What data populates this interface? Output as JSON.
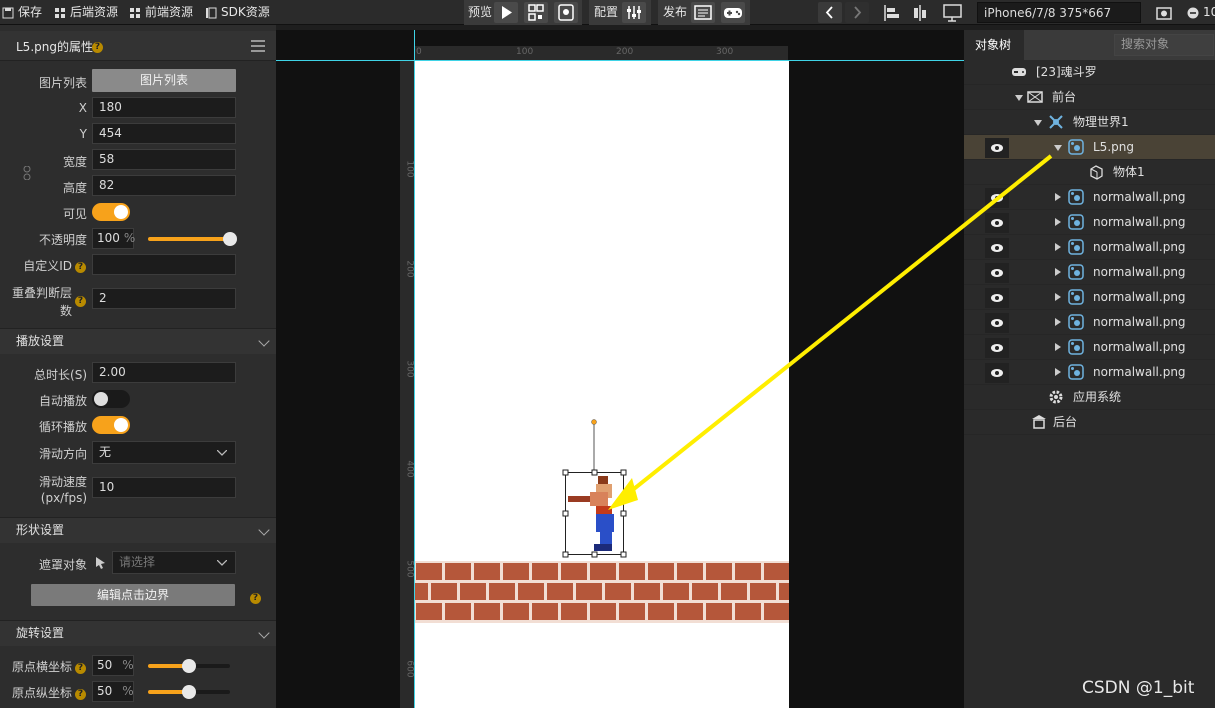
{
  "toolbar": {
    "save": "保存",
    "backend_assets": "后端资源",
    "frontend_assets": "前端资源",
    "sdk_assets": "SDK资源",
    "preview": "预览",
    "config": "配置",
    "publish": "发布",
    "device": "iPhone6/7/8 375*667",
    "zoom": "10"
  },
  "left_panel": {
    "title": "L5.png的属性",
    "image_list_label": "图片列表",
    "image_list_button": "图片列表",
    "x_label": "X",
    "x_value": "180",
    "y_label": "Y",
    "y_value": "454",
    "width_label": "宽度",
    "width_value": "58",
    "height_label": "高度",
    "height_value": "82",
    "visible_label": "可见",
    "visible": true,
    "opacity_label": "不透明度",
    "opacity_value": "100",
    "opacity_unit": "%",
    "opacity_level": 1.0,
    "custom_id_label": "自定义ID",
    "custom_id_value": "",
    "overlap_label_1": "重叠判断层",
    "overlap_label_2": "数",
    "overlap_value": "2",
    "playback": {
      "title": "播放设置",
      "duration_label": "总时长(S)",
      "duration_value": "2.00",
      "autoplay_label": "自动播放",
      "autoplay": false,
      "loop_label": "循环播放",
      "loop": true,
      "scroll_dir_label": "滑动方向",
      "scroll_dir_value": "无",
      "scroll_speed_label_1": "滑动速度",
      "scroll_speed_label_2": "(px/fps)",
      "scroll_speed_value": "10"
    },
    "shape": {
      "title": "形状设置",
      "mask_label": "遮罩对象",
      "mask_placeholder": "请选择",
      "edit_bounds_button": "编辑点击边界"
    },
    "rotation": {
      "title": "旋转设置",
      "origin_x_label": "原点横坐标",
      "origin_x_value": "50",
      "origin_y_label": "原点纵坐标",
      "origin_y_value": "50",
      "unit": "%",
      "origin_x_level": 0.5,
      "origin_y_level": 0.5
    }
  },
  "canvas": {
    "ruler_h": [
      "0",
      "100",
      "200",
      "300"
    ],
    "ruler_v": [
      "100",
      "200",
      "300",
      "400",
      "500",
      "600"
    ]
  },
  "right_panel": {
    "tab_tree": "对象树",
    "search_placeholder": "搜索对象",
    "nodes": [
      {
        "label": "[23]魂斗罗",
        "icon": "gamepad-icon"
      },
      {
        "label": "前台",
        "icon": "stage-icon"
      },
      {
        "label": "物理世界1",
        "icon": "physics-icon"
      },
      {
        "label": "L5.png",
        "icon": "sprite-icon"
      },
      {
        "label": "物体1",
        "icon": "cube-icon"
      },
      {
        "label": "normalwall.png",
        "icon": "sprite-icon"
      },
      {
        "label": "normalwall.png",
        "icon": "sprite-icon"
      },
      {
        "label": "normalwall.png",
        "icon": "sprite-icon"
      },
      {
        "label": "normalwall.png",
        "icon": "sprite-icon"
      },
      {
        "label": "normalwall.png",
        "icon": "sprite-icon"
      },
      {
        "label": "normalwall.png",
        "icon": "sprite-icon"
      },
      {
        "label": "normalwall.png",
        "icon": "sprite-icon"
      },
      {
        "label": "normalwall.png",
        "icon": "sprite-icon"
      },
      {
        "label": "应用系统",
        "icon": "gear-icon"
      },
      {
        "label": "后台",
        "icon": "backstage-icon"
      }
    ]
  },
  "watermark": "CSDN @1_bit"
}
